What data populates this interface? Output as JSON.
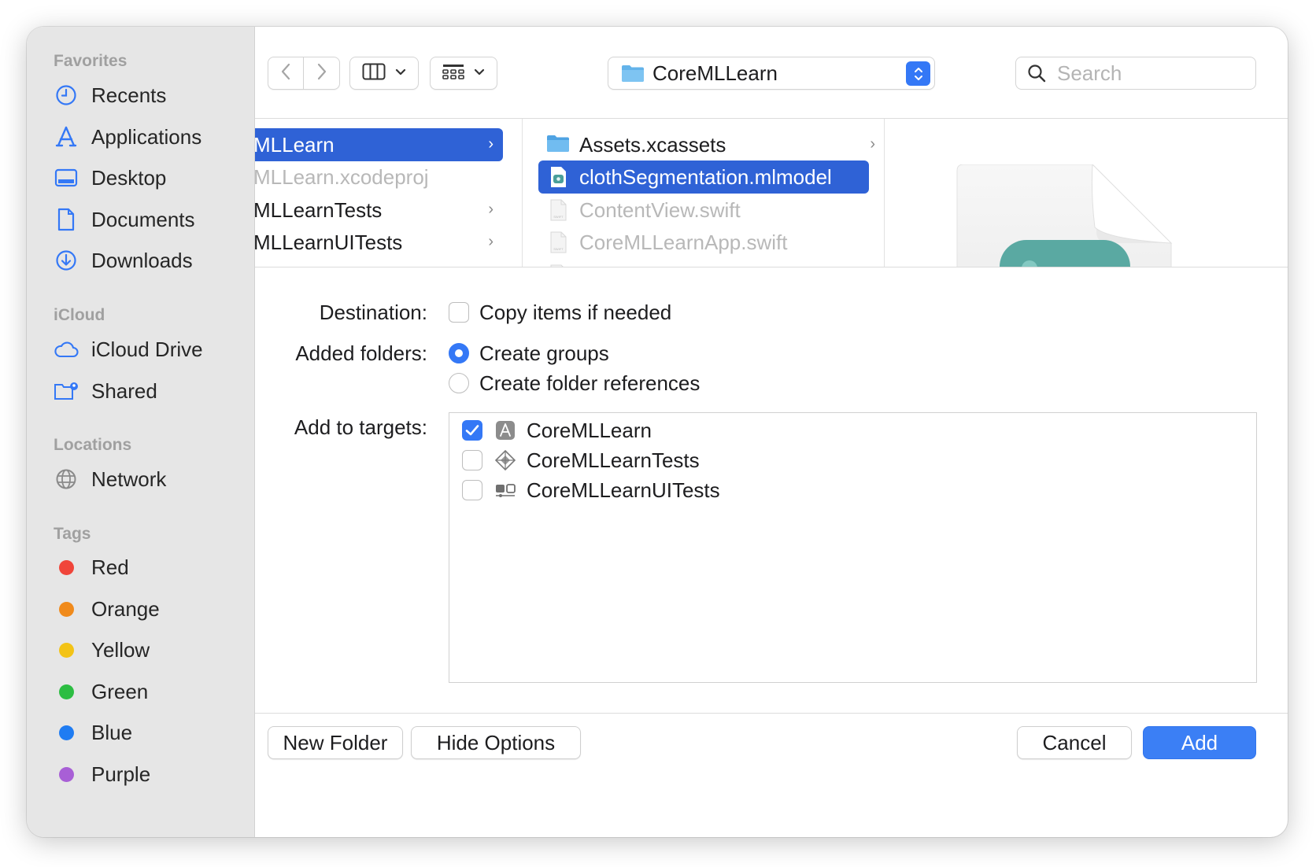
{
  "sidebar": {
    "favorites_title": "Favorites",
    "favorites": [
      {
        "label": "Recents",
        "icon": "clock-icon"
      },
      {
        "label": "Applications",
        "icon": "applications-icon"
      },
      {
        "label": "Desktop",
        "icon": "desktop-icon"
      },
      {
        "label": "Documents",
        "icon": "document-icon"
      },
      {
        "label": "Downloads",
        "icon": "download-icon"
      }
    ],
    "icloud_title": "iCloud",
    "icloud": [
      {
        "label": "iCloud Drive",
        "icon": "cloud-icon"
      },
      {
        "label": "Shared",
        "icon": "shared-folder-icon"
      }
    ],
    "locations_title": "Locations",
    "locations": [
      {
        "label": "Network",
        "icon": "globe-icon"
      }
    ],
    "tags_title": "Tags",
    "tags": [
      {
        "label": "Red",
        "color": "#f0453a"
      },
      {
        "label": "Orange",
        "color": "#f08a1b"
      },
      {
        "label": "Yellow",
        "color": "#f3c316"
      },
      {
        "label": "Green",
        "color": "#2cbd42"
      },
      {
        "label": "Blue",
        "color": "#1f7cf2"
      },
      {
        "label": "Purple",
        "color": "#a85fd6"
      }
    ]
  },
  "toolbar": {
    "path_label": "CoreMLLearn",
    "search_placeholder": "Search"
  },
  "browser": {
    "col1": [
      {
        "label": "MLLearn",
        "selected": true,
        "chevron": true
      },
      {
        "label": "MLLearn.xcodeproj",
        "dim": true
      },
      {
        "label": "MLLearnTests",
        "chevron": true
      },
      {
        "label": "MLLearnUITests",
        "chevron": true
      }
    ],
    "col2": [
      {
        "label": "Assets.xcassets",
        "icon": "folder-icon",
        "chevron": true
      },
      {
        "label": "clothSegmentation.mlmodel",
        "icon": "mlmodel-icon",
        "selected": true
      },
      {
        "label": "ContentView.swift",
        "icon": "swift-file-icon",
        "dim": true
      },
      {
        "label": "CoreMLLearnApp.swift",
        "icon": "swift-file-icon",
        "dim": true
      }
    ]
  },
  "options": {
    "destination_label": "Destination:",
    "copy_items_label": "Copy items if needed",
    "copy_items_checked": false,
    "added_folders_label": "Added folders:",
    "create_groups_label": "Create groups",
    "create_folder_refs_label": "Create folder references",
    "selected_folder_option": "Create groups",
    "targets_label": "Add to targets:",
    "targets": [
      {
        "name": "CoreMLLearn",
        "checked": true,
        "icon": "app-target-icon"
      },
      {
        "name": "CoreMLLearnTests",
        "checked": false,
        "icon": "unit-test-target-icon"
      },
      {
        "name": "CoreMLLearnUITests",
        "checked": false,
        "icon": "ui-test-target-icon"
      }
    ]
  },
  "buttons": {
    "new_folder": "New Folder",
    "hide_options": "Hide Options",
    "cancel": "Cancel",
    "add": "Add"
  },
  "colors": {
    "accent": "#3478f6",
    "selection": "#2f62d6",
    "sidebar_bg": "#e6e6e6"
  }
}
